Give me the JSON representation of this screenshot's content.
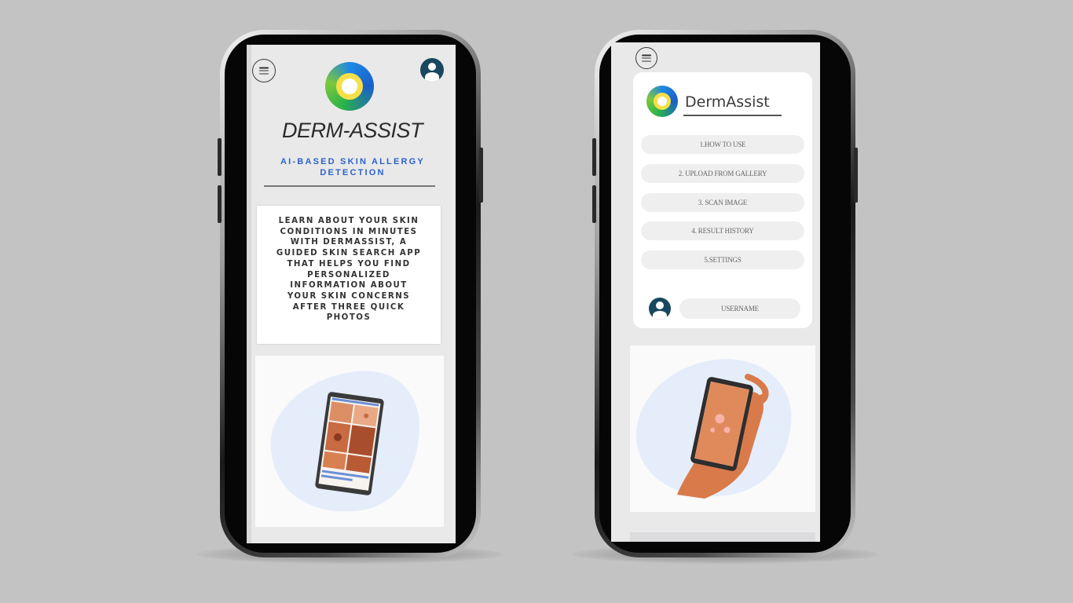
{
  "left_phone": {
    "menu_icon": "hamburger-icon",
    "profile_icon": "user-avatar-icon",
    "logo_icon": "circular-gradient-logo-icon",
    "app_title": "DERM-ASSIST",
    "subtitle": "AI-BASED SKIN ALLERGY DETECTION",
    "description": "LEARN ABOUT YOUR SKIN CONDITIONS IN MINUTES WITH DERMASSIST, A GUIDED SKIN SEARCH APP THAT HELPS YOU FIND PERSONALIZED INFORMATION ABOUT YOUR SKIN CONCERNS AFTER THREE QUICK PHOTOS",
    "illustration": "phone-with-skin-photo-grid-illustration"
  },
  "right_phone": {
    "menu_icon": "hamburger-icon",
    "logo_icon": "circular-gradient-logo-icon",
    "brand_name": "DermAssist",
    "menu_items": [
      {
        "label": "1.HOW TO USE"
      },
      {
        "label": "2. UPLOAD FROM GALLERY"
      },
      {
        "label": "3. SCAN IMAGE"
      },
      {
        "label": "4. RESULT HISTORY"
      },
      {
        "label": "5.SETTINGS"
      }
    ],
    "user_icon": "user-avatar-icon",
    "username_label": "USERNAME",
    "illustration": "hand-scanning-skin-with-phone-illustration"
  },
  "colors": {
    "background": "#c3c3c3",
    "accent_blue": "#2d63c8",
    "avatar_navy": "#17485f",
    "illustration_orange": "#d97a4a",
    "blob_blue": "#e5edfb"
  }
}
